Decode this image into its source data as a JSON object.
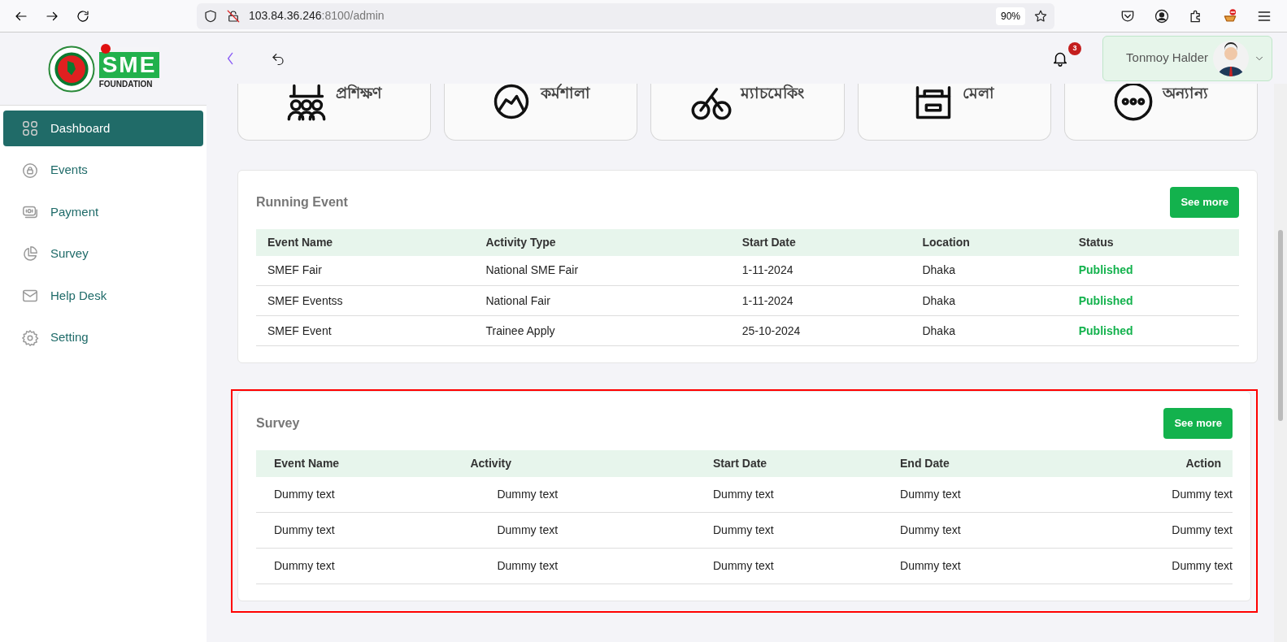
{
  "browser": {
    "url_host": "103.84.36.246",
    "url_rest": ":8100/admin",
    "zoom": "90%"
  },
  "header": {
    "notifications": "3",
    "user_name": "Tonmoy Halder"
  },
  "logo": {
    "brand": "SME",
    "sub": "FOUNDATION"
  },
  "sidebar": {
    "items": [
      {
        "label": "Dashboard",
        "selected": true
      },
      {
        "label": "Events",
        "selected": false
      },
      {
        "label": "Payment",
        "selected": false
      },
      {
        "label": "Survey",
        "selected": false
      },
      {
        "label": "Help Desk",
        "selected": false
      },
      {
        "label": "Setting",
        "selected": false
      }
    ]
  },
  "categories": [
    {
      "label": "প্রশিক্ষণ"
    },
    {
      "label": "কর্মশালা"
    },
    {
      "label": "ম্যাচমেকিং"
    },
    {
      "label": "মেলা"
    },
    {
      "label": "অন্যান্য"
    }
  ],
  "running_event": {
    "title": "Running Event",
    "button": "See more",
    "columns": [
      "Event Name",
      "Activity Type",
      "Start Date",
      "Location",
      "Status"
    ],
    "rows": [
      [
        "SMEF Fair",
        "National SME Fair",
        "1-11-2024",
        "Dhaka",
        "Published"
      ],
      [
        "SMEF Eventss",
        "National Fair",
        "1-11-2024",
        "Dhaka",
        "Published"
      ],
      [
        "SMEF Event",
        "Trainee Apply",
        "25-10-2024",
        "Dhaka",
        "Published"
      ]
    ]
  },
  "survey": {
    "title": "Survey",
    "button": "See more",
    "highlighted": true,
    "columns": [
      "Event Name",
      "Activity",
      "Start Date",
      "End Date",
      "Action"
    ],
    "rows": [
      [
        "Dummy text",
        "Dummy text",
        "Dummy text",
        "Dummy text",
        "Dummy text"
      ],
      [
        "Dummy text",
        "Dummy text",
        "Dummy text",
        "Dummy text",
        "Dummy text"
      ],
      [
        "Dummy text",
        "Dummy text",
        "Dummy text",
        "Dummy text",
        "Dummy text"
      ]
    ]
  }
}
